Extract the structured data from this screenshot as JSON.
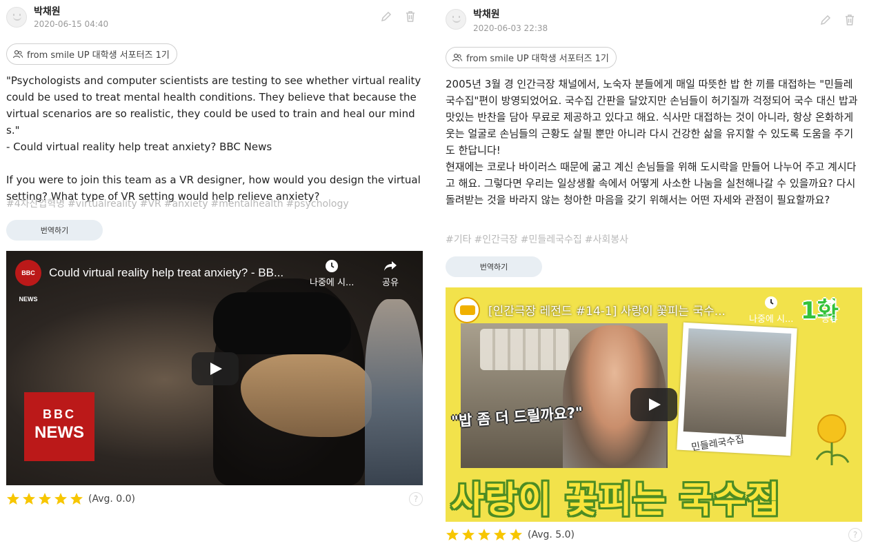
{
  "posts": [
    {
      "author": "박채원",
      "date": "2020-06-15 04:40",
      "source": "from smile UP 대학생 서포터즈 1기",
      "body": "\"Psychologists and computer scientists are testing to see whether virtual reality could be used to treat mental health conditions. They believe that because the virtual scenarios are so realistic, they could be used to train and heal our minds.\"\n- Could virtual reality help treat anxiety? BBC News\n\nIf you were to join this team as a VR designer, how would you design the virtual setting? What type of VR setting would help relieve anxiety?",
      "tags": [
        "#4차산업혁명",
        "#virtualreality",
        "#VR",
        "#anxiety",
        "#mentalhealth",
        "#psychology"
      ],
      "translate_label": "번역하기",
      "video": {
        "title": "Could virtual reality help treat anxiety? - BB...",
        "channel_badge": "BBC NEWS",
        "watch_later": "나중에 시...",
        "share": "공유",
        "logo_line1": "BBC",
        "logo_line2": "NEWS"
      },
      "rating": {
        "stars": 5,
        "avg_text": "(Avg. 0.0)",
        "star_color": "#f7c600"
      },
      "help": "?"
    },
    {
      "author": "박채원",
      "date": "2020-06-03 22:38",
      "source": "from smile UP 대학생 서포터즈 1기",
      "body": "2005년 3월 경 인간극장 채널에서, 노숙자 분들에게 매일 따뜻한 밥 한 끼를 대접하는 \"민들레 국수집\"편이 방영되었어요. 국수집 간판을 달았지만 손님들이 허기질까 걱정되어 국수 대신 밥과 맛있는 반찬을 담아 무료로 제공하고 있다고 해요. 식사만 대접하는 것이 아니라, 항상 온화하게 웃는 얼굴로 손님들의 근황도 살필 뿐만 아니라 다시 건강한 삶을 유지할 수 있도록 도움을 주기도 한답니다!\n현재에는 코로나 바이러스 때문에 굶고 계신 손님들을 위해 도시락을 만들어 나누어 주고 계시다고 해요. 그렇다면 우리는 일상생활 속에서 어떻게 사소한 나눔을 실천해나갈 수 있을까요? 다시 돌려받는 것을 바라지 않는 청아한 마음을 갖기 위해서는 어떤 자세와 관점이 필요할까요?",
      "tags": [
        "#기타",
        "#인간극장",
        "#민들레국수집",
        "#사회봉사"
      ],
      "translate_label": "번역하기",
      "video": {
        "title": "[인간극장 레전드 #14-1] 사랑이 꽃피는 국수...",
        "watch_later": "나중에 시...",
        "share": "공유",
        "episode_badge": "1화",
        "speech_text": "\"밥 좀 더 드릴까요?\"",
        "sign_text": "민들레국수집",
        "banner_text": "사랑이 꽃피는 국수집"
      },
      "rating": {
        "stars": 5,
        "avg_text": "(Avg. 5.0)",
        "star_color": "#f7c600"
      },
      "help": "?"
    }
  ]
}
